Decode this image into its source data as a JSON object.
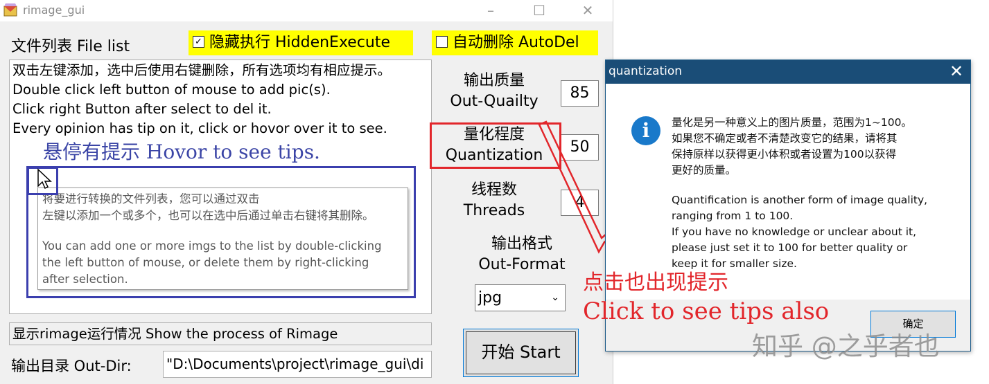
{
  "window": {
    "title": "rimage_gui"
  },
  "main": {
    "file_list_label": "文件列表 File list",
    "hidden_execute": {
      "label": "隐藏执行 HiddenExecute",
      "checked": true
    },
    "auto_delete": {
      "label": "自动删除 AutoDel",
      "checked": false
    },
    "file_list_lines": [
      "双击左键添加，选中后使用右键删除，所有选项均有相应提示。",
      "Double click left button of mouse to add pic(s).",
      "Click right Button after select to del it.",
      "Every opinion has tip on it, click or hovor over it to see."
    ],
    "tooltip_lines": [
      "将要进行转换的文件列表，您可以通过双击",
      "左键以添加一个或多个，也可以在选中后通过单击右键将其删除。",
      "",
      "You can add one or more imgs to the list by double-clicking",
      "the left button of mouse, or delete them by right-clicking",
      "after selection."
    ],
    "quality": {
      "label_cn": "输出质量",
      "label_en": "Out-Quailty",
      "value": "85"
    },
    "quantization": {
      "label_cn": "量化程度",
      "label_en": "Quantization",
      "value": "50"
    },
    "threads": {
      "label_cn": "线程数",
      "label_en": "Threads",
      "value": "4"
    },
    "format": {
      "label_cn": "输出格式",
      "label_en": "Out-Format",
      "selected": "jpg"
    },
    "start_button": "开始 Start",
    "status_text": "显示rimage运行情况 Show the process of Rimage",
    "outdir_label": "输出目录 Out-Dir:",
    "outdir_value": "\"D:\\Documents\\project\\rimage_gui\\di"
  },
  "annotations": {
    "hover_hint": "悬停有提示 Hovor to see tips.",
    "click_hint_cn": "点击也出现提示",
    "click_hint_en": "Click to see tips also",
    "watermark": "知乎 @之乎者也",
    "colors": {
      "red": "#e2262b",
      "blue": "#3b3fae",
      "highlight": "#ffff00"
    }
  },
  "dialog": {
    "title": "quantization",
    "close_icon": "close-icon",
    "message_lines": [
      "量化是另一种意义上的图片质量，范围为1~100。",
      "如果您不确定或者不清楚改变它的结果，请将其",
      "保持原样以获得更小体积或者设置为100以获得",
      "更好的质量。",
      "",
      "Quantification is another form of image quality,",
      "ranging from 1 to 100.",
      "If you have no knowledge or unclear about it,",
      "please just set it to 100 for better quality or",
      "keep it for smaller size."
    ],
    "ok_button": "确定"
  }
}
